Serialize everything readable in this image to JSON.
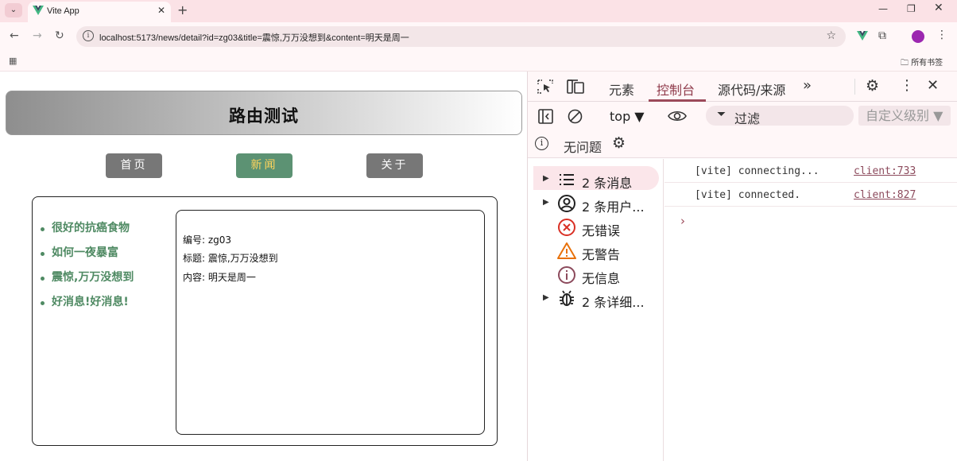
{
  "browser": {
    "tab_title": "Vite App",
    "url": "localhost:5173/news/detail?id=zg03&title=震惊,万万没想到&content=明天是周一",
    "bookmarks_label": "所有书签"
  },
  "page": {
    "title": "路由测试",
    "nav": [
      {
        "label": "首页",
        "active": false
      },
      {
        "label": "新闻",
        "active": true
      },
      {
        "label": "关于",
        "active": false
      }
    ],
    "news_list": [
      "很好的抗癌食物",
      "如何一夜暴富",
      "震惊,万万没想到",
      "好消息!好消息!"
    ],
    "detail": {
      "id_line": "编号: zg03",
      "title_line": "标题: 震惊,万万没想到",
      "content_line": "内容: 明天是周一"
    }
  },
  "devtools": {
    "tabs": [
      "元素",
      "控制台",
      "源代码/来源"
    ],
    "active_tab": "控制台",
    "context": "top ▼",
    "filter_placeholder": "过滤",
    "levels_label": "自定义级别 ▼",
    "issues_label": "无问题",
    "sidebar": [
      {
        "label": "2 条消息",
        "icon": "list-icon",
        "expandable": true
      },
      {
        "label": "2 条用户...",
        "icon": "user-icon",
        "expandable": true
      },
      {
        "label": "无错误",
        "icon": "error-icon",
        "expandable": false
      },
      {
        "label": "无警告",
        "icon": "warning-icon",
        "expandable": false
      },
      {
        "label": "无信息",
        "icon": "info-icon",
        "expandable": false
      },
      {
        "label": "2 条详细...",
        "icon": "bug-icon",
        "expandable": true
      }
    ],
    "logs": [
      {
        "message": "[vite] connecting...",
        "source": "client:733"
      },
      {
        "message": "[vite] connected.",
        "source": "client:827"
      }
    ]
  },
  "colors": {
    "accent": "#5c9273",
    "active_nav_text": "#ffd45c",
    "devtools_accent": "#9c4a5a"
  }
}
